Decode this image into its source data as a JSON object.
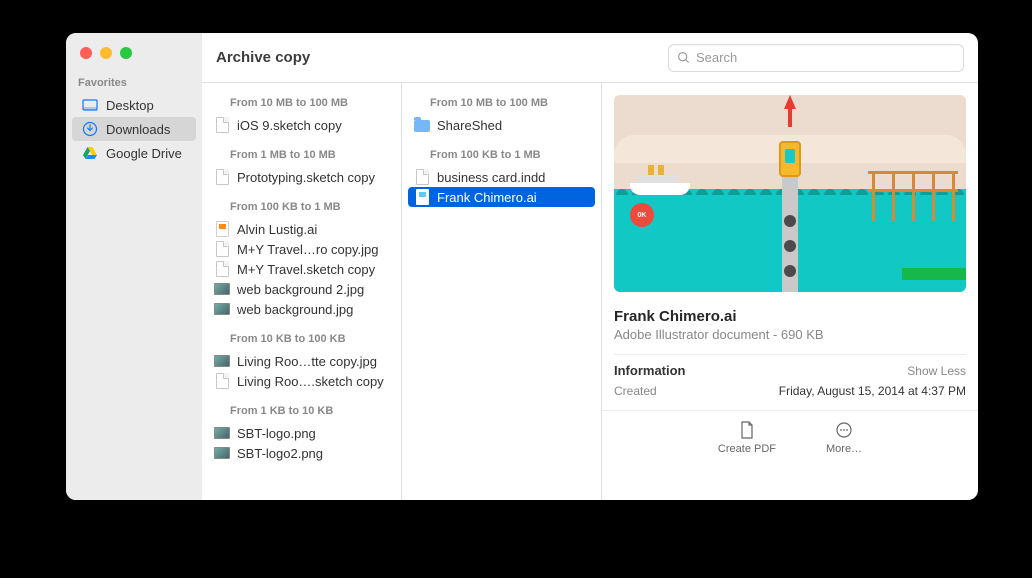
{
  "window_title": "Archive copy",
  "search": {
    "placeholder": "Search"
  },
  "sidebar": {
    "section": "Favorites",
    "items": [
      {
        "label": "Desktop"
      },
      {
        "label": "Downloads"
      },
      {
        "label": "Google Drive"
      }
    ]
  },
  "col1": {
    "groups": [
      {
        "label": "From 10 MB to 100 MB",
        "items": [
          {
            "name": "iOS 9.sketch copy",
            "kind": "generic"
          }
        ]
      },
      {
        "label": "From 1 MB to 10 MB",
        "items": [
          {
            "name": "Prototyping.sketch copy",
            "kind": "generic"
          }
        ]
      },
      {
        "label": "From 100 KB to 1 MB",
        "items": [
          {
            "name": "Alvin Lustig.ai",
            "kind": "ai"
          },
          {
            "name": "M+Y Travel…ro copy.jpg",
            "kind": "generic"
          },
          {
            "name": "M+Y Travel.sketch copy",
            "kind": "generic"
          },
          {
            "name": "web background 2.jpg",
            "kind": "img"
          },
          {
            "name": "web background.jpg",
            "kind": "img"
          }
        ]
      },
      {
        "label": "From 10 KB to 100 KB",
        "items": [
          {
            "name": "Living Roo…tte copy.jpg",
            "kind": "img"
          },
          {
            "name": "Living Roo….sketch copy",
            "kind": "generic"
          }
        ]
      },
      {
        "label": "From 1 KB to 10 KB",
        "items": [
          {
            "name": "SBT-logo.png",
            "kind": "img"
          },
          {
            "name": "SBT-logo2.png",
            "kind": "img"
          }
        ]
      }
    ]
  },
  "col2": {
    "groups": [
      {
        "label": "From 10 MB to 100 MB",
        "items": [
          {
            "name": "ShareShed",
            "kind": "folder"
          }
        ]
      },
      {
        "label": "From 100 KB to 1 MB",
        "items": [
          {
            "name": "business card.indd",
            "kind": "generic"
          },
          {
            "name": "Frank Chimero.ai",
            "kind": "ai-sel",
            "selected": true
          }
        ]
      }
    ]
  },
  "preview": {
    "name": "Frank Chimero.ai",
    "type": "Adobe Illustrator document - 690 KB",
    "info_label": "Information",
    "show_less": "Show Less",
    "created_label": "Created",
    "created_value": "Friday, August 15, 2014 at 4:37 PM",
    "badge": "0K"
  },
  "actions": {
    "create_pdf": "Create PDF",
    "more": "More…"
  }
}
